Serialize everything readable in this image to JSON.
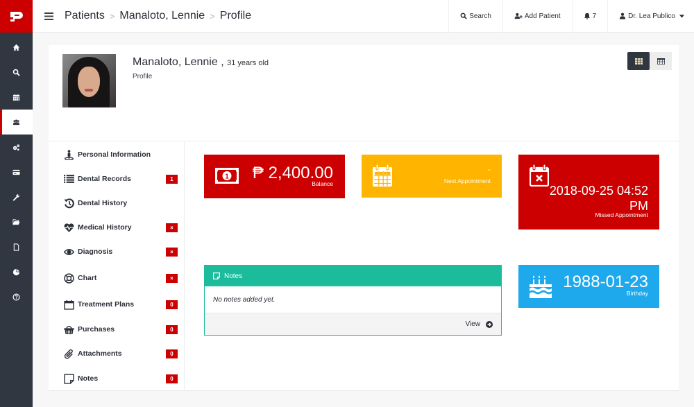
{
  "brand": {
    "logo_letter": "P",
    "color": "#cc0000"
  },
  "sidebar": {
    "items": [
      {
        "icon": "home-icon",
        "active": false
      },
      {
        "icon": "search-icon",
        "active": false
      },
      {
        "icon": "calendar-icon",
        "active": false
      },
      {
        "icon": "users-icon",
        "active": true
      },
      {
        "icon": "gears-icon",
        "active": false
      },
      {
        "icon": "credit-card-icon",
        "active": false
      },
      {
        "icon": "wrench-icon",
        "active": false
      },
      {
        "icon": "folder-open-icon",
        "active": false
      },
      {
        "icon": "file-icon",
        "active": false
      },
      {
        "icon": "pie-chart-icon",
        "active": false
      },
      {
        "icon": "help-icon",
        "active": false
      }
    ]
  },
  "topbar": {
    "breadcrumb": [
      "Patients",
      "Manaloto, Lennie",
      "Profile"
    ],
    "search_label": "Search",
    "add_patient_label": "Add Patient",
    "notification_count": "7",
    "user_name": "Dr. Lea Publico"
  },
  "profile": {
    "name": "Manaloto, Lennie",
    "name_sep": " , ",
    "age": "31 years old",
    "subtitle": "Profile",
    "view_modes": [
      {
        "icon": "grid-icon",
        "active": true
      },
      {
        "icon": "table-icon",
        "active": false
      }
    ]
  },
  "menu": {
    "items": [
      {
        "label": "Personal Information",
        "icon": "user-pin-icon",
        "badge": null
      },
      {
        "label": "Dental Records",
        "icon": "list-icon",
        "badge": "1"
      },
      {
        "label": "Dental History",
        "icon": "history-icon",
        "badge": null
      },
      {
        "label": "Medical History",
        "icon": "heartbeat-icon",
        "badge": "×"
      },
      {
        "label": "Diagnosis",
        "icon": "eye-icon",
        "badge": "×"
      },
      {
        "label": "Chart",
        "icon": "life-ring-icon",
        "badge": "×"
      },
      {
        "label": "Treatment Plans",
        "icon": "calendar-plan-icon",
        "badge": "0"
      },
      {
        "label": "Purchases",
        "icon": "basket-icon",
        "badge": "0"
      },
      {
        "label": "Attachments",
        "icon": "paperclip-icon",
        "badge": "0"
      },
      {
        "label": "Notes",
        "icon": "sticky-note-icon",
        "badge": "0"
      }
    ]
  },
  "tiles": {
    "balance": {
      "value": "₱ 2,400.00",
      "label": "Balance",
      "color": "#cc0000"
    },
    "next_appointment": {
      "value": "-",
      "label": "Next Appointment",
      "color": "#ffb400"
    },
    "missed_appointment": {
      "value_line1": "2018-09-25 04:52",
      "value_line2": "PM",
      "label": "Missed Appointment",
      "color": "#cc0000"
    },
    "birthday": {
      "value": "1988-01-23",
      "label": "Birthday",
      "color": "#1ea9ec"
    }
  },
  "notes": {
    "title": "Notes",
    "empty_text": "No notes added yet.",
    "view_label": "View",
    "color": "#1bbc9b"
  }
}
